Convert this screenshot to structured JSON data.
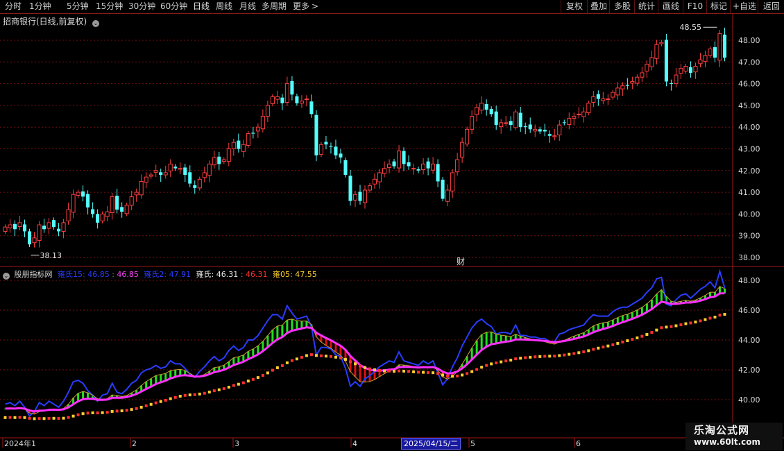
{
  "toolbar": {
    "periods": [
      "分时",
      "1分钟",
      "5分钟",
      "15分钟",
      "30分钟",
      "60分钟",
      "日线",
      "周线",
      "月线",
      "多周期",
      "更多"
    ],
    "more_arrow": ">",
    "right_buttons": [
      "复权",
      "叠加",
      "多股",
      "统计",
      "画线",
      "F10",
      "标记",
      "+自选",
      "返回"
    ]
  },
  "main_chart": {
    "title": "招商银行(日线,前复权)",
    "high_label": "48.55",
    "low_label": "38.13",
    "price_ticks": [
      "48.00",
      "47.00",
      "46.00",
      "45.00",
      "44.00",
      "43.00",
      "42.00",
      "41.00",
      "40.00",
      "39.00",
      "38.00"
    ],
    "finance_marker": "财",
    "candle_closes": [
      39.4,
      39.5,
      39.3,
      39.6,
      39.2,
      38.6,
      38.9,
      39.5,
      39.3,
      39.6,
      39.4,
      39.2,
      39.6,
      40.2,
      40.9,
      41.0,
      40.8,
      40.3,
      40.0,
      39.6,
      40.0,
      40.1,
      40.8,
      40.2,
      40.1,
      40.4,
      40.8,
      41.0,
      41.5,
      41.7,
      41.8,
      42.0,
      41.8,
      41.9,
      42.3,
      42.1,
      42.1,
      41.8,
      41.4,
      41.2,
      41.6,
      41.9,
      42.3,
      42.6,
      42.3,
      42.5,
      43.0,
      43.3,
      43.0,
      43.2,
      43.7,
      43.7,
      44.0,
      44.5,
      45.0,
      45.4,
      45.4,
      45.1,
      46.0,
      45.5,
      45.1,
      45.2,
      45.3,
      44.6,
      42.7,
      43.2,
      43.2,
      43.1,
      42.7,
      42.6,
      41.8,
      40.6,
      40.9,
      40.6,
      41.1,
      41.3,
      41.6,
      41.9,
      42.1,
      42.3,
      42.2,
      42.9,
      42.3,
      42.2,
      42.1,
      42.0,
      42.3,
      42.1,
      42.3,
      41.5,
      40.7,
      41.1,
      41.9,
      42.5,
      43.3,
      43.9,
      44.5,
      44.9,
      45.1,
      44.8,
      44.6,
      44.1,
      44.2,
      44.2,
      44.1,
      44.7,
      44.0,
      44.0,
      43.9,
      43.9,
      43.8,
      43.8,
      43.6,
      43.6,
      44.1,
      44.2,
      44.4,
      44.5,
      44.6,
      44.7,
      45.1,
      45.4,
      45.3,
      45.3,
      45.3,
      45.6,
      45.8,
      45.9,
      45.9,
      46.1,
      46.3,
      46.5,
      46.9,
      47.2,
      47.8,
      47.9,
      46.1,
      46.0,
      46.4,
      46.7,
      46.8,
      46.5,
      46.8,
      47.1,
      47.3,
      47.6,
      47.2,
      48.3,
      47.2
    ]
  },
  "indicator": {
    "name": "股朋指标网",
    "values": [
      {
        "label": "雍氏15: 46.85",
        "color": "#2a3cff"
      },
      {
        "label": "46.85",
        "color": "#ff44ff"
      },
      {
        "label": "雍氏2: 47.91",
        "color": "#2a3cff"
      },
      {
        "label": "雍氏: 46.31",
        "color": "#e8e8e8"
      },
      {
        "label": "46.31",
        "color": "#ff3030"
      },
      {
        "label": "雍05: 47.55",
        "color": "#ffd030"
      }
    ],
    "price_ticks": [
      "48.00",
      "46.00",
      "44.00",
      "42.00",
      "40.00"
    ]
  },
  "time_axis": {
    "labels": [
      "2024年1",
      "2",
      "3",
      "4",
      "5",
      "6"
    ],
    "selected_date": "2025/04/15/二"
  },
  "watermark": {
    "line1": "乐淘公式网",
    "line2": "www.60lt.com"
  },
  "colors": {
    "up": "#ff4040",
    "down": "#54ffff",
    "grid": "#7a1010",
    "axis": "#a01818"
  }
}
